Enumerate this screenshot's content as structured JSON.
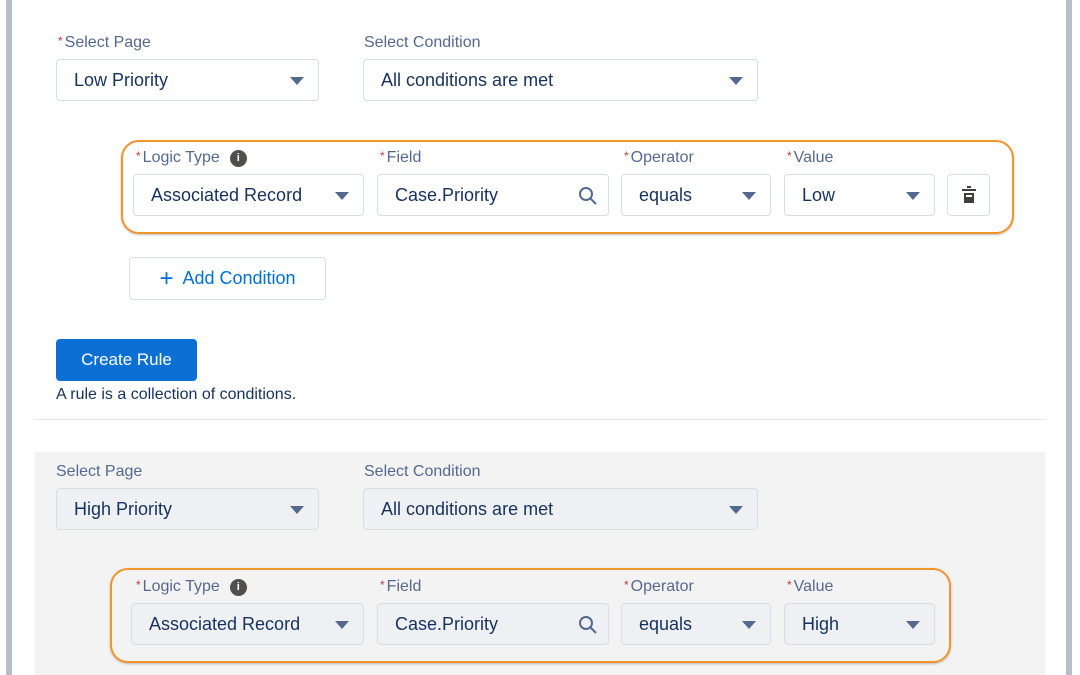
{
  "rule1": {
    "select_page_label": "Select Page",
    "select_page_value": "Low Priority",
    "select_condition_label": "Select Condition",
    "select_condition_value": "All conditions are met",
    "condition": {
      "logic_type_label": "Logic Type",
      "logic_type_value": "Associated Record",
      "field_label": "Field",
      "field_value": "Case.Priority",
      "operator_label": "Operator",
      "operator_value": "equals",
      "value_label": "Value",
      "value_value": "Low"
    },
    "add_condition_label": "Add Condition",
    "create_rule_label": "Create Rule",
    "help_text": "A rule is a collection of conditions."
  },
  "rule2": {
    "select_page_label": "Select Page",
    "select_page_value": "High Priority",
    "select_condition_label": "Select Condition",
    "select_condition_value": "All conditions are met",
    "condition": {
      "logic_type_label": "Logic Type",
      "logic_type_value": "Associated Record",
      "field_label": "Field",
      "field_value": "Case.Priority",
      "operator_label": "Operator",
      "operator_value": "equals",
      "value_label": "Value",
      "value_value": "High"
    }
  },
  "required_marker": "*",
  "info_glyph": "i",
  "colors": {
    "highlight": "#f0942c",
    "brand": "#0b6fd4",
    "required": "#c23934"
  }
}
